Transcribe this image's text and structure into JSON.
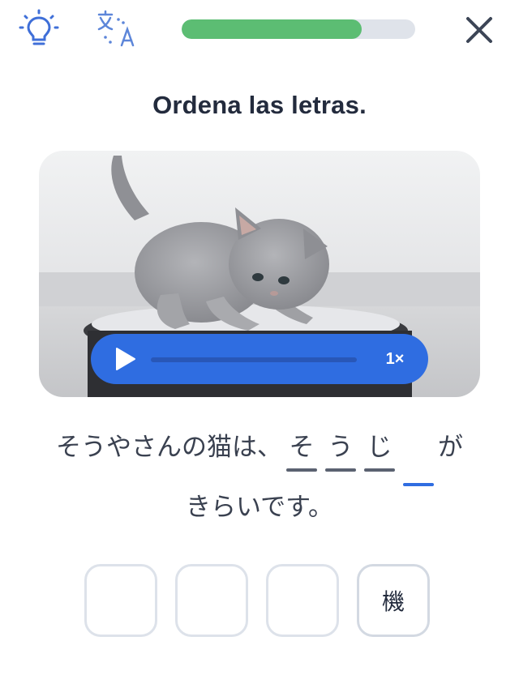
{
  "header": {
    "hint_icon": "lightbulb-icon",
    "translate_icon": "translate-icon",
    "close_icon": "close-icon",
    "progress_fraction": 0.77,
    "progress_color": "#5cbd73"
  },
  "instruction": "Ordena las letras.",
  "media": {
    "image_icon": "kitten-on-robot-vacuum-image",
    "play_icon": "play-icon",
    "speed_label": "1×",
    "accent_color": "#2f6de1"
  },
  "sentence": {
    "prefix": "そうやさんの猫は、",
    "blanks": [
      "そ",
      "う",
      "じ",
      ""
    ],
    "suffix_line1": "が",
    "line2": "きらいです。"
  },
  "tiles": [
    "",
    "",
    "",
    "機"
  ]
}
